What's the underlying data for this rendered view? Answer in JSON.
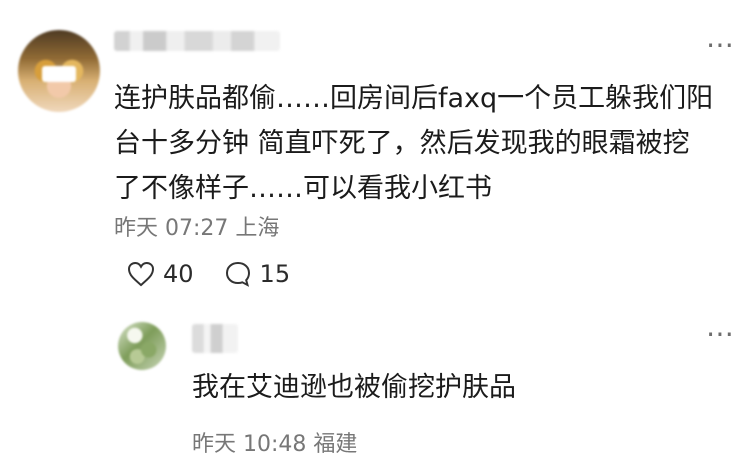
{
  "comment": {
    "text": "连护肤品都偷……回房间后faxq一个员工躲我们阳\n台十多分钟 简直吓死了，然后发现我的眼霜被挖\n了不像样子……可以看我小红书",
    "meta": "昨天 07:27 上海",
    "likes": "40",
    "replies": "15",
    "more": "⋯"
  },
  "reply": {
    "text": "我在艾迪逊也被偷挖护肤品",
    "meta": "昨天 10:48 福建",
    "more": "⋯"
  }
}
